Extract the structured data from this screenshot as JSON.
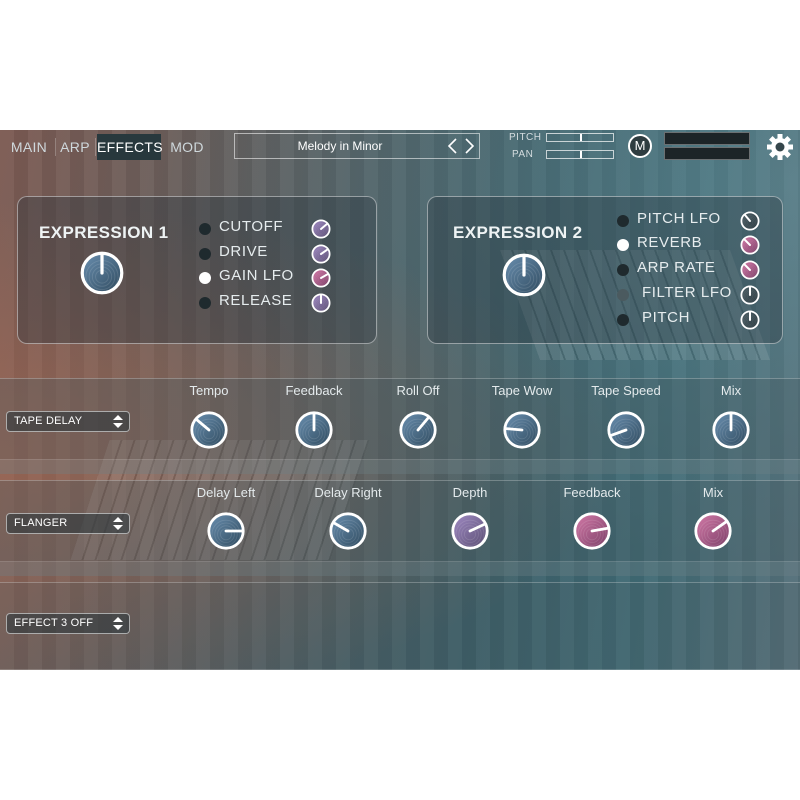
{
  "tabs": [
    {
      "label": "MAIN",
      "active": false
    },
    {
      "label": "ARP",
      "active": false
    },
    {
      "label": "EFFECTS",
      "active": true
    },
    {
      "label": "MOD",
      "active": false
    }
  ],
  "preset": {
    "name": "Melody in Minor",
    "prev_icon": "chevron-left-icon",
    "next_icon": "chevron-right-icon"
  },
  "mini_controls": {
    "pitch_label": "PITCH",
    "pan_label": "PAN"
  },
  "m_button": {
    "label": "M"
  },
  "settings": {
    "icon": "gear-icon"
  },
  "expression1": {
    "title": "EXPRESSION 1",
    "destinations": [
      {
        "label": "CUTOFF",
        "active": false,
        "knob_color": "purple"
      },
      {
        "label": "DRIVE",
        "active": false,
        "knob_color": "purple"
      },
      {
        "label": "GAIN LFO",
        "active": true,
        "knob_color": "pink"
      },
      {
        "label": "RELEASE",
        "active": false,
        "knob_color": "purple"
      }
    ]
  },
  "expression2": {
    "title": "EXPRESSION 2",
    "destinations": [
      {
        "label": "PITCH LFO",
        "active": false,
        "knob_color": "dark"
      },
      {
        "label": "REVERB",
        "active": true,
        "knob_color": "pink"
      },
      {
        "label": "ARP RATE",
        "active": false,
        "knob_color": "pink"
      },
      {
        "label": "FILTER LFO",
        "active": false,
        "knob_color": "dark"
      },
      {
        "label": "PITCH",
        "active": false,
        "knob_color": "dark"
      }
    ]
  },
  "effect1": {
    "selector": "TAPE DELAY",
    "params": [
      {
        "label": "Tempo"
      },
      {
        "label": "Feedback"
      },
      {
        "label": "Roll Off"
      },
      {
        "label": "Tape Wow"
      },
      {
        "label": "Tape Speed"
      },
      {
        "label": "Mix"
      }
    ]
  },
  "effect2": {
    "selector": "FLANGER",
    "params": [
      {
        "label": "Delay Left"
      },
      {
        "label": "Delay Right"
      },
      {
        "label": "Depth"
      },
      {
        "label": "Feedback"
      },
      {
        "label": "Mix"
      }
    ]
  },
  "effect3": {
    "selector": "EFFECT 3 OFF"
  },
  "colors": {
    "accent_pink": "#b45a8a",
    "knob_blue": "#3b5a72",
    "panel_dark": "#28383d"
  }
}
